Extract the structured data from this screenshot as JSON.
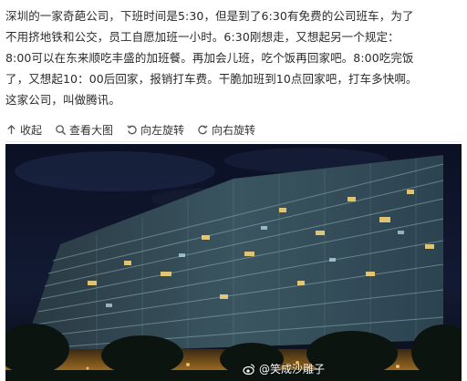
{
  "article": {
    "lines": [
      "深圳的一家奇葩公司，下班时间是5:30，但是到了6:30有免费的公司班车，为了",
      "不用挤地铁和公交，员工自愿加班一小时。6:30刚想走，又想起另一个规定：",
      "8:00可以在东来顺吃丰盛的加班餐。再加会儿班，吃个饭再回家吧。8:00吃完饭",
      "了，又想起10：00后回家，报销打车费。干脆加班到10点回家吧，打车多快啊。",
      "这家公司，叫做腾讯。"
    ]
  },
  "toolbar": {
    "collapse": "收起",
    "view_large": "查看大图",
    "rotate_left": "向左旋转",
    "rotate_right": "向右旋转"
  },
  "photo": {
    "watermark": "@笑成沙雕子",
    "watermark_icon": "weibo-icon"
  }
}
